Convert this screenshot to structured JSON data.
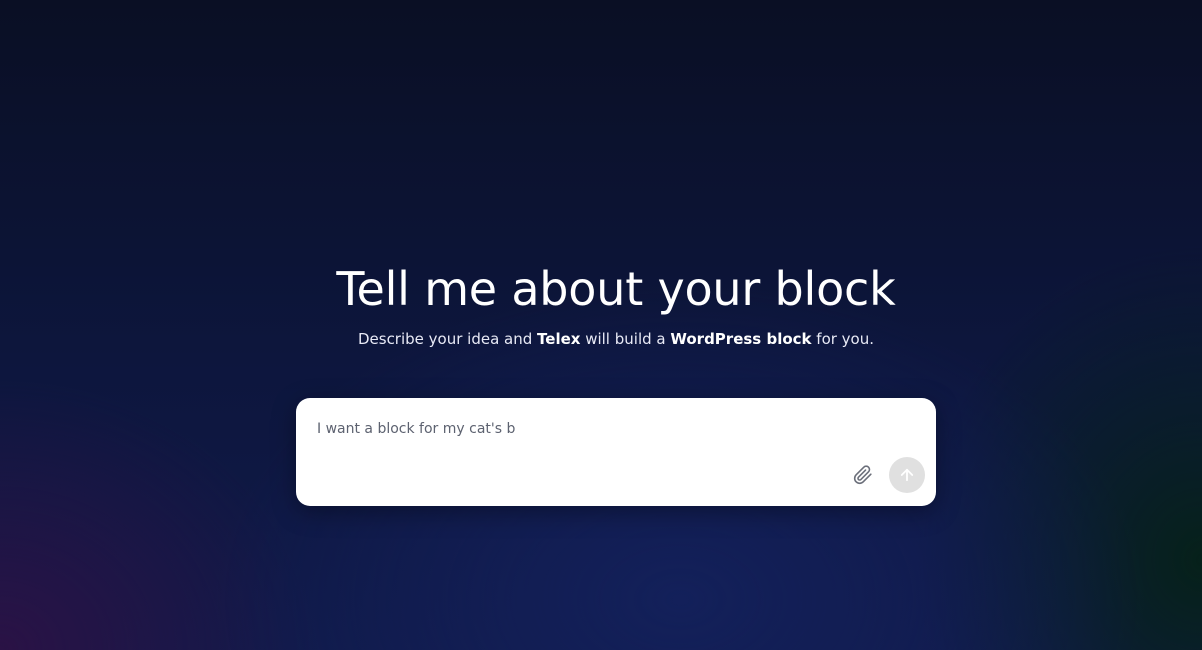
{
  "hero": {
    "title": "Tell me about your block",
    "subtitle": {
      "part1": "Describe your idea and ",
      "brand": "Telex",
      "part2": " will build a ",
      "product": "WordPress block",
      "part3": " for you."
    }
  },
  "prompt": {
    "value": "I want a block for my cat's b",
    "attach_icon": "paperclip-icon",
    "send_icon": "arrow-up-icon"
  },
  "colors": {
    "background_top": "#0a0f24",
    "background_center": "#13205a",
    "card": "#ffffff",
    "send_button": "#e0e0e0"
  }
}
